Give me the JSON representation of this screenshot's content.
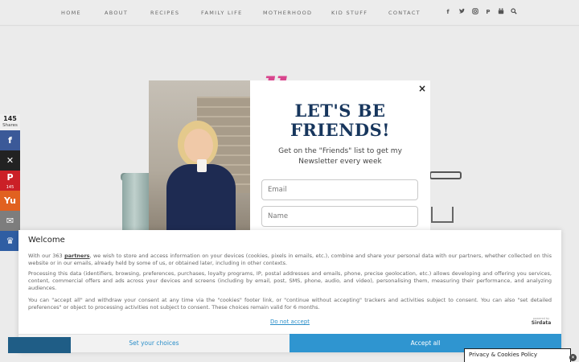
{
  "nav": {
    "items": [
      "HOME",
      "ABOUT",
      "RECIPES",
      "FAMILY LIFE",
      "MOTHERHOOD",
      "KID STUFF",
      "CONTACT"
    ],
    "icons": [
      "facebook-icon",
      "twitter-icon",
      "instagram-icon",
      "pinterest-icon",
      "youtube-icon",
      "search-icon"
    ]
  },
  "share": {
    "total": "145",
    "total_label": "Shares",
    "buttons": [
      {
        "name": "facebook",
        "glyph": "f",
        "color": "#3b5998",
        "count": ""
      },
      {
        "name": "x",
        "glyph": "✕",
        "color": "#222222",
        "count": ""
      },
      {
        "name": "pinterest",
        "glyph": "P",
        "color": "#cb2027",
        "count": "145"
      },
      {
        "name": "yummly",
        "glyph": "Yu",
        "color": "#e16120",
        "count": ""
      },
      {
        "name": "email",
        "glyph": "✉",
        "color": "#7d7d7d",
        "count": ""
      },
      {
        "name": "grow",
        "glyph": "♛",
        "color": "#2f5ea3",
        "count": ""
      }
    ]
  },
  "modal": {
    "close": "×",
    "title": "LET'S BE FRIENDS!",
    "subtitle": "Get on the \"Friends\" list to get my Newsletter every week",
    "email_placeholder": "Email",
    "name_placeholder": "Name",
    "title_color": "#17365d"
  },
  "consent": {
    "title": "Welcome",
    "p1_before": "With our 363 ",
    "p1_link": "partners",
    "p1_after": ", we wish to store and access information on your devices (cookies, pixels in emails, etc.), combine and share your personal data with our partners, whether collected on this website or in our emails, already held by some of us, or obtained later, including in other contexts.",
    "p2": "Processing this data (identifiers, browsing, preferences, purchases, loyalty programs, IP, postal addresses and emails, phone, precise geolocation, etc.) allows developing and offering you services, content, commercial offers and ads across your devices and screens (including by email, post, SMS, phone, audio, and video), personalising them, measuring their performance, and analyzing audiences.",
    "p3": "You can \"accept all\" and withdraw your consent at any time via the \"cookies\" footer link, or \"continue without accepting\" trackers and activities subject to consent. You can also \"set detailed preferences\" or object to processing activities not subject to consent. These choices remain valid for 6 months.",
    "reject": "Do not accept",
    "powered_by": "powered by",
    "powered_brand": "Sirdata",
    "set_choices": "Set your choices",
    "accept_all": "Accept all",
    "accent_color": "#2f95d0"
  },
  "footer": {
    "privacy": "Privacy & Cookies Policy"
  }
}
